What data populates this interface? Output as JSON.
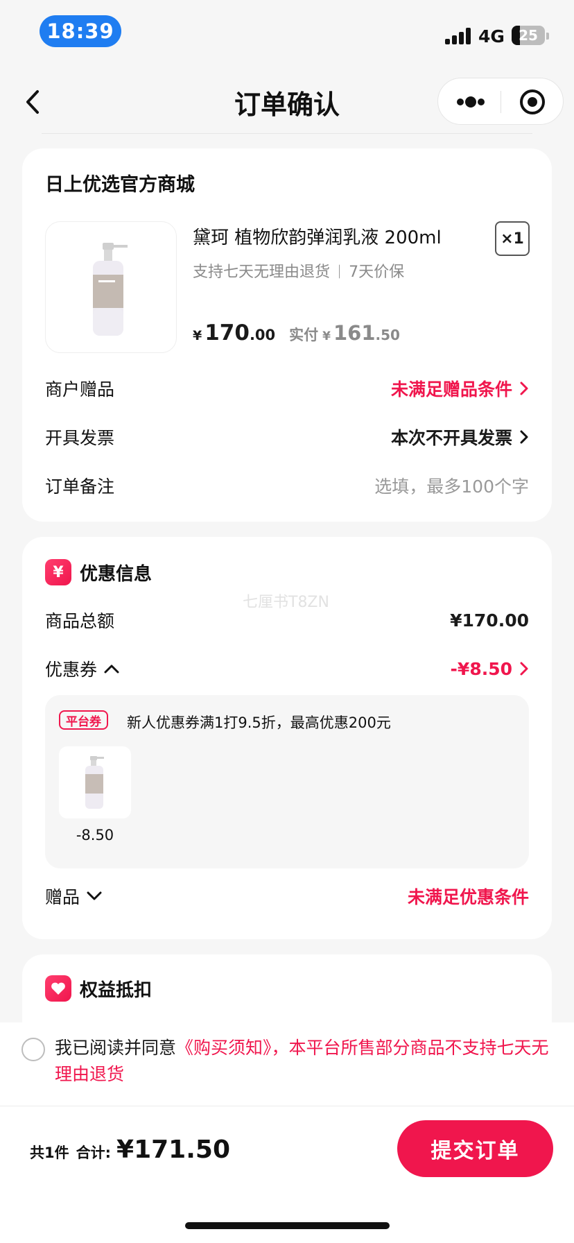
{
  "status_bar": {
    "time": "18:39",
    "network": "4G",
    "battery": "25",
    "battery_level": 0.25
  },
  "nav": {
    "title": "订单确认"
  },
  "order": {
    "store_name": "日上优选官方商城",
    "product": {
      "title": "黛珂 植物欣韵弹润乳液 200ml",
      "subtitle": "支持七天无理由退货 ᛁ 7天价保",
      "quantity": "×1",
      "price_symbol": "¥",
      "price_int": "170",
      "price_dec": ".00",
      "paid_label": "实付",
      "paid_symbol": "¥",
      "paid_int": "161",
      "paid_dec": ".50"
    },
    "rows": {
      "gift_label": "商户赠品",
      "gift_value": "未满足赠品条件",
      "invoice_label": "开具发票",
      "invoice_value": "本次不开具发票",
      "note_label": "订单备注",
      "note_placeholder": "选填，最多100个字"
    }
  },
  "discount": {
    "icon_char": "¥",
    "title": "优惠信息",
    "watermark": "七厘书T8ZN",
    "subtotal_label": "商品总额",
    "subtotal_value": "¥170.00",
    "coupon_label": "优惠券",
    "coupon_value": "-¥8.50",
    "coupon_detail": {
      "tag": "平台券",
      "desc": "新人优惠券满1打9.5折，最高优惠200元",
      "item_amount": "-8.50"
    },
    "gift_label": "赠品",
    "gift_value": "未满足优惠条件"
  },
  "benefits": {
    "title": "权益抵扣"
  },
  "agreement": {
    "prefix": "我已阅读并同意",
    "link": "《购买须知》，本平台所售部分商品不支持七天无理由退货"
  },
  "footer": {
    "count": "共1件",
    "total_label": "合计:",
    "total_value": "¥171.50",
    "submit_label": "提交订单"
  },
  "colors": {
    "accent": "#f0164d",
    "time_pill": "#1f7df1"
  }
}
